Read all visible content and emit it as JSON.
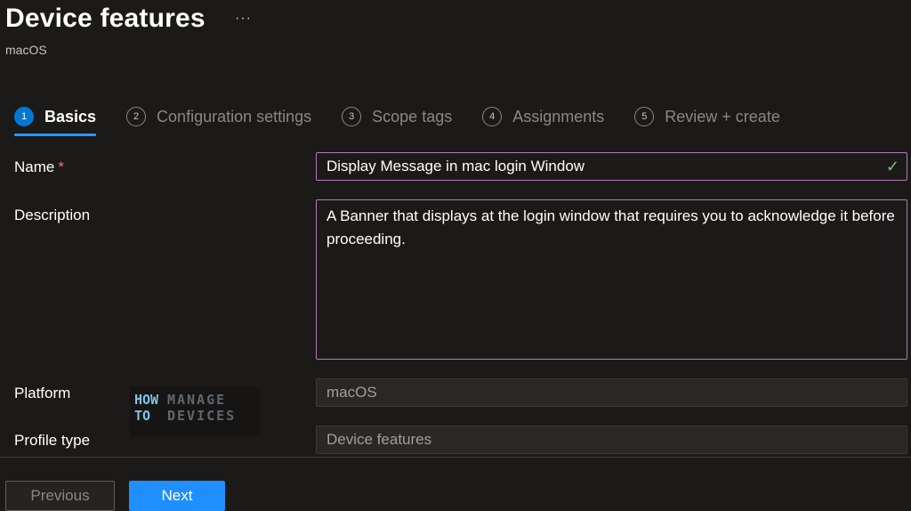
{
  "header": {
    "title": "Device features",
    "more_label": "···",
    "subtitle": "macOS"
  },
  "wizard": {
    "steps": [
      {
        "number": "1",
        "label": "Basics",
        "active": true
      },
      {
        "number": "2",
        "label": "Configuration settings",
        "active": false
      },
      {
        "number": "3",
        "label": "Scope tags",
        "active": false
      },
      {
        "number": "4",
        "label": "Assignments",
        "active": false
      },
      {
        "number": "5",
        "label": "Review + create",
        "active": false
      }
    ]
  },
  "form": {
    "name": {
      "label": "Name",
      "required_marker": "*",
      "value": "Display Message in mac login Window",
      "valid_icon": "checkmark-icon"
    },
    "description": {
      "label": "Description",
      "value": "A Banner that displays at the login window that requires you to acknowledge it before proceeding."
    },
    "platform": {
      "label": "Platform",
      "value": "macOS"
    },
    "profile_type": {
      "label": "Profile type",
      "value": "Device features"
    }
  },
  "watermark": {
    "line1_left": "HOW",
    "line2_left": "TO",
    "line1_right": "MANAGE",
    "line2_right": "DEVICES"
  },
  "footer": {
    "previous_label": "Previous",
    "next_label": "Next"
  },
  "colors": {
    "background": "#1b1a19",
    "accent": "#0078d4",
    "next_button": "#1f8fff",
    "field_border": "#b47ab6",
    "valid": "#7fba7a",
    "required": "#f1707b"
  }
}
